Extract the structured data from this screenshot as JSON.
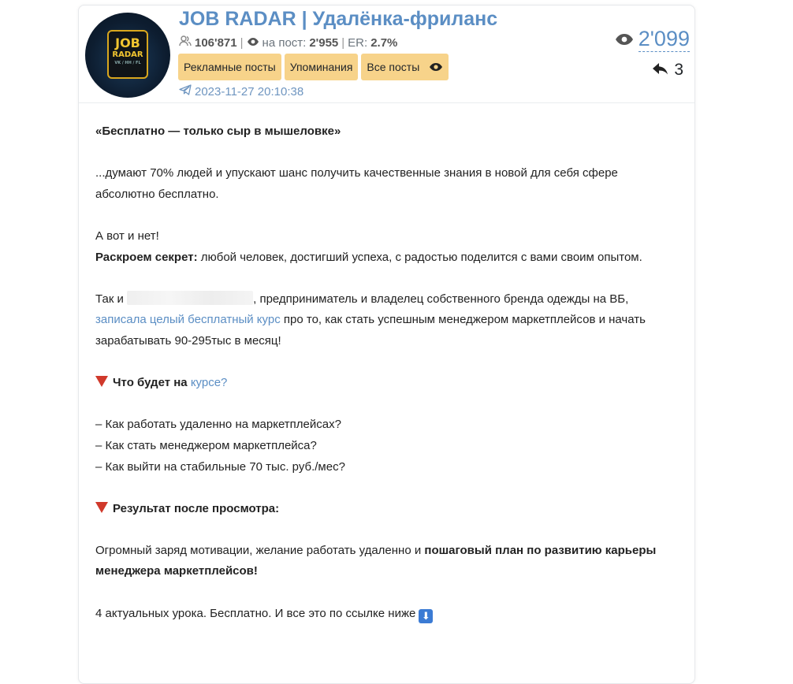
{
  "channel": {
    "title": "JOB RADAR | Удалёнка-фриланс",
    "avatar_text": [
      "JOB",
      "RADAR",
      "VK / HH / FL"
    ],
    "subscribers": "106'871",
    "per_post_label": "на пост:",
    "per_post": "2'955",
    "er_label": "ER:",
    "er": "2.7%",
    "separator": "|"
  },
  "buttons": {
    "ads": "Рекламные посты",
    "mentions": "Упоминания",
    "all": "Все посты"
  },
  "post": {
    "date": "2023-11-27 20:10:38",
    "views": "2'099",
    "reposts": "3"
  },
  "content": {
    "heading": "«Бесплатно — только сыр в мышеловке»",
    "p1": "...думают 70% людей и упускают шанс получить качественные знания в новой для себя сфере абсолютно бесплатно.",
    "p2_line1": "А вот и нет!",
    "p2_bold": "Раскроем секрет:",
    "p2_rest": " любой человек, достигший успеха, с радостью поделится с вами своим опытом.",
    "p3_a": "Так и ",
    "p3_b": ", предприниматель и владелец собственного бренда одежды на ВБ, ",
    "p3_link": "записала целый бесплатный курс",
    "p3_c": " про то, как стать успешным менеджером маркетплейсов и начать зарабатывать 90-295тыс в месяц!",
    "s1_bold": "Что будет на ",
    "s1_link": "курсе?",
    "list": [
      "– Как работать удаленно на маркетплейсах?",
      "– Как стать менеджером маркетплейса?",
      "– Как выйти на стабильные 70 тыс. руб./мес?"
    ],
    "s2_bold": "Результат после просмотра:",
    "p4_normal": "Огромный заряд мотивации, желание работать удаленно и ",
    "p4_bold": "пошаговый план по развитию карьеры менеджера маркетплейсов!",
    "p5": "4 актуальных урока. Бесплатно. И все это по ссылке ниже",
    "p5_icon": "⬇"
  },
  "colors": {
    "accent": "#5b8ec4",
    "button_bg": "#f7d38a",
    "triangle": "#d0392b"
  },
  "icons": [
    "users-icon",
    "eye-icon",
    "telegram-icon",
    "reply-icon",
    "down-arrow-icon",
    "red-triangle-icon"
  ]
}
